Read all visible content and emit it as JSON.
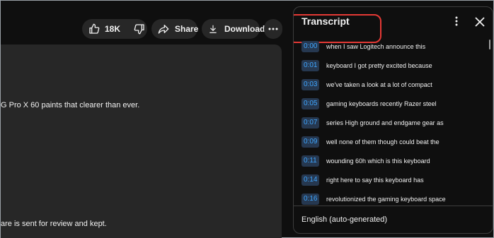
{
  "actions": {
    "like_count": "18K",
    "share_label": "Share",
    "download_label": "Download"
  },
  "description": {
    "line1": "G Pro X 60 paints that clearer than ever.",
    "line2": "are is sent for review and kept."
  },
  "transcript": {
    "title": "Transcript",
    "segments": [
      {
        "time": "0:00",
        "text": "when I saw Logitech announce this"
      },
      {
        "time": "0:01",
        "text": "keyboard I got pretty excited because"
      },
      {
        "time": "0:03",
        "text": "we've taken a look at a lot of compact"
      },
      {
        "time": "0:05",
        "text": "gaming keyboards recently Razer steel"
      },
      {
        "time": "0:07",
        "text": "series High ground and endgame gear as"
      },
      {
        "time": "0:09",
        "text": "well none of them though could beat the"
      },
      {
        "time": "0:11",
        "text": "wounding 60h which is this keyboard"
      },
      {
        "time": "0:14",
        "text": "right here to say this keyboard has"
      },
      {
        "time": "0:16",
        "text": "revolutionized the gaming keyboard space"
      }
    ],
    "language": "English (auto-generated)"
  },
  "icons": {
    "like": "thumbs-up-icon",
    "dislike": "thumbs-down-icon",
    "share": "share-arrow-icon",
    "download": "download-icon",
    "more": "more-horizontal-icon",
    "menu": "more-vertical-icon",
    "close": "close-icon"
  },
  "colors": {
    "background": "#0f0f0f",
    "pill": "#272727",
    "timestamp_text": "#3ea6ff",
    "timestamp_bg": "#263850",
    "highlight": "#e53935"
  }
}
